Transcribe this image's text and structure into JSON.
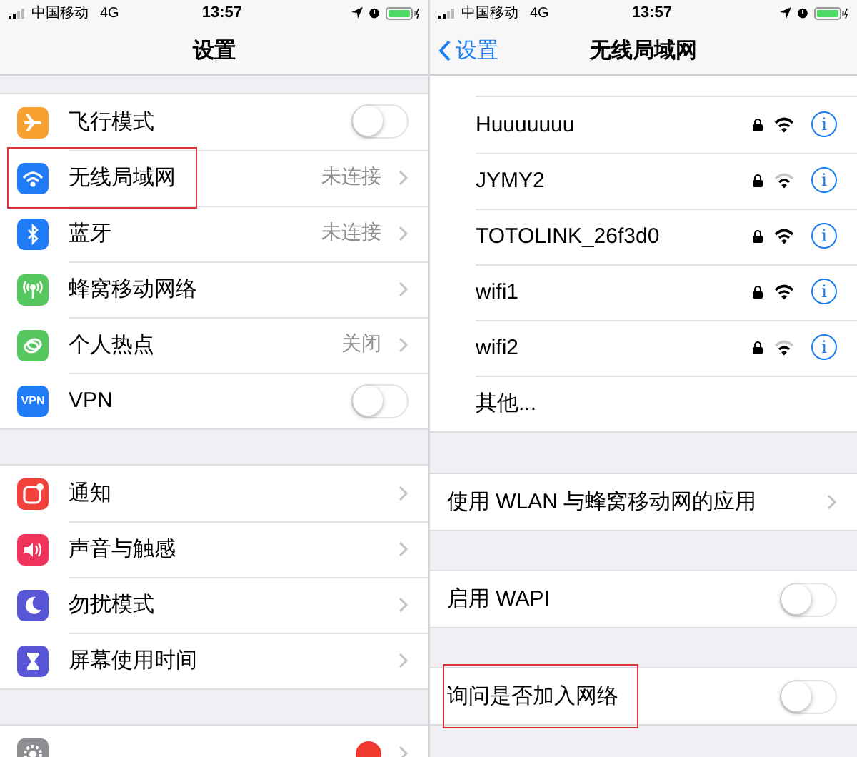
{
  "left": {
    "status_bar": {
      "carrier": "中国移动",
      "network": "4G",
      "time": "13:57"
    },
    "title": "设置",
    "groups": [
      {
        "items": [
          {
            "label": "飞行模式",
            "color": "#f7a132",
            "kind": "toggle",
            "on": false,
            "highlighted": false
          },
          {
            "label": "无线局域网",
            "color": "#1f7cf6",
            "kind": "link",
            "value": "未连接",
            "highlighted": true
          },
          {
            "label": "蓝牙",
            "color": "#1f7cf6",
            "kind": "link",
            "value": "未连接",
            "highlighted": false
          },
          {
            "label": "蜂窝移动网络",
            "color": "#56c75f",
            "kind": "link",
            "highlighted": false
          },
          {
            "label": "个人热点",
            "color": "#56c75f",
            "kind": "link",
            "value": "关闭",
            "highlighted": false
          },
          {
            "label": "VPN",
            "color": "#1f7cf6",
            "kind": "toggle",
            "on": false,
            "highlighted": false,
            "icon_text": "VPN"
          }
        ]
      },
      {
        "items": [
          {
            "label": "通知",
            "color": "#f0423b",
            "kind": "link",
            "highlighted": false
          },
          {
            "label": "声音与触感",
            "color": "#f0335a",
            "kind": "link",
            "highlighted": false
          },
          {
            "label": "勿扰模式",
            "color": "#5856d6",
            "kind": "link",
            "highlighted": false
          },
          {
            "label": "屏幕使用时间",
            "color": "#5856d6",
            "kind": "link",
            "highlighted": false
          }
        ]
      },
      {
        "items": [
          {
            "color": "#8e8e93",
            "kind": "link",
            "badge": true,
            "highlighted": false
          }
        ]
      }
    ]
  },
  "right": {
    "status_bar": {
      "carrier": "中国移动",
      "network": "4G",
      "time": "13:57"
    },
    "back": "设置",
    "title": "无线局域网",
    "networks": [
      {
        "name": "Huuuuuuu",
        "weak": false,
        "info": "i"
      },
      {
        "name": "JYMY2",
        "weak": true,
        "info": "i"
      },
      {
        "name": "TOTOLINK_26f3d0",
        "weak": false,
        "info": "i"
      },
      {
        "name": "wifi1",
        "weak": false,
        "info": "i"
      },
      {
        "name": "wifi2",
        "weak": true,
        "info": "i"
      }
    ],
    "other": "其他...",
    "rows": [
      {
        "label": "使用 WLAN 与蜂窝移动网的应用",
        "kind": "link",
        "highlighted": false
      },
      {
        "label": "启用 WAPI",
        "kind": "toggle",
        "on": false,
        "highlighted": false
      },
      {
        "label": "询问是否加入网络",
        "kind": "toggle",
        "on": false,
        "highlighted": true
      }
    ]
  }
}
